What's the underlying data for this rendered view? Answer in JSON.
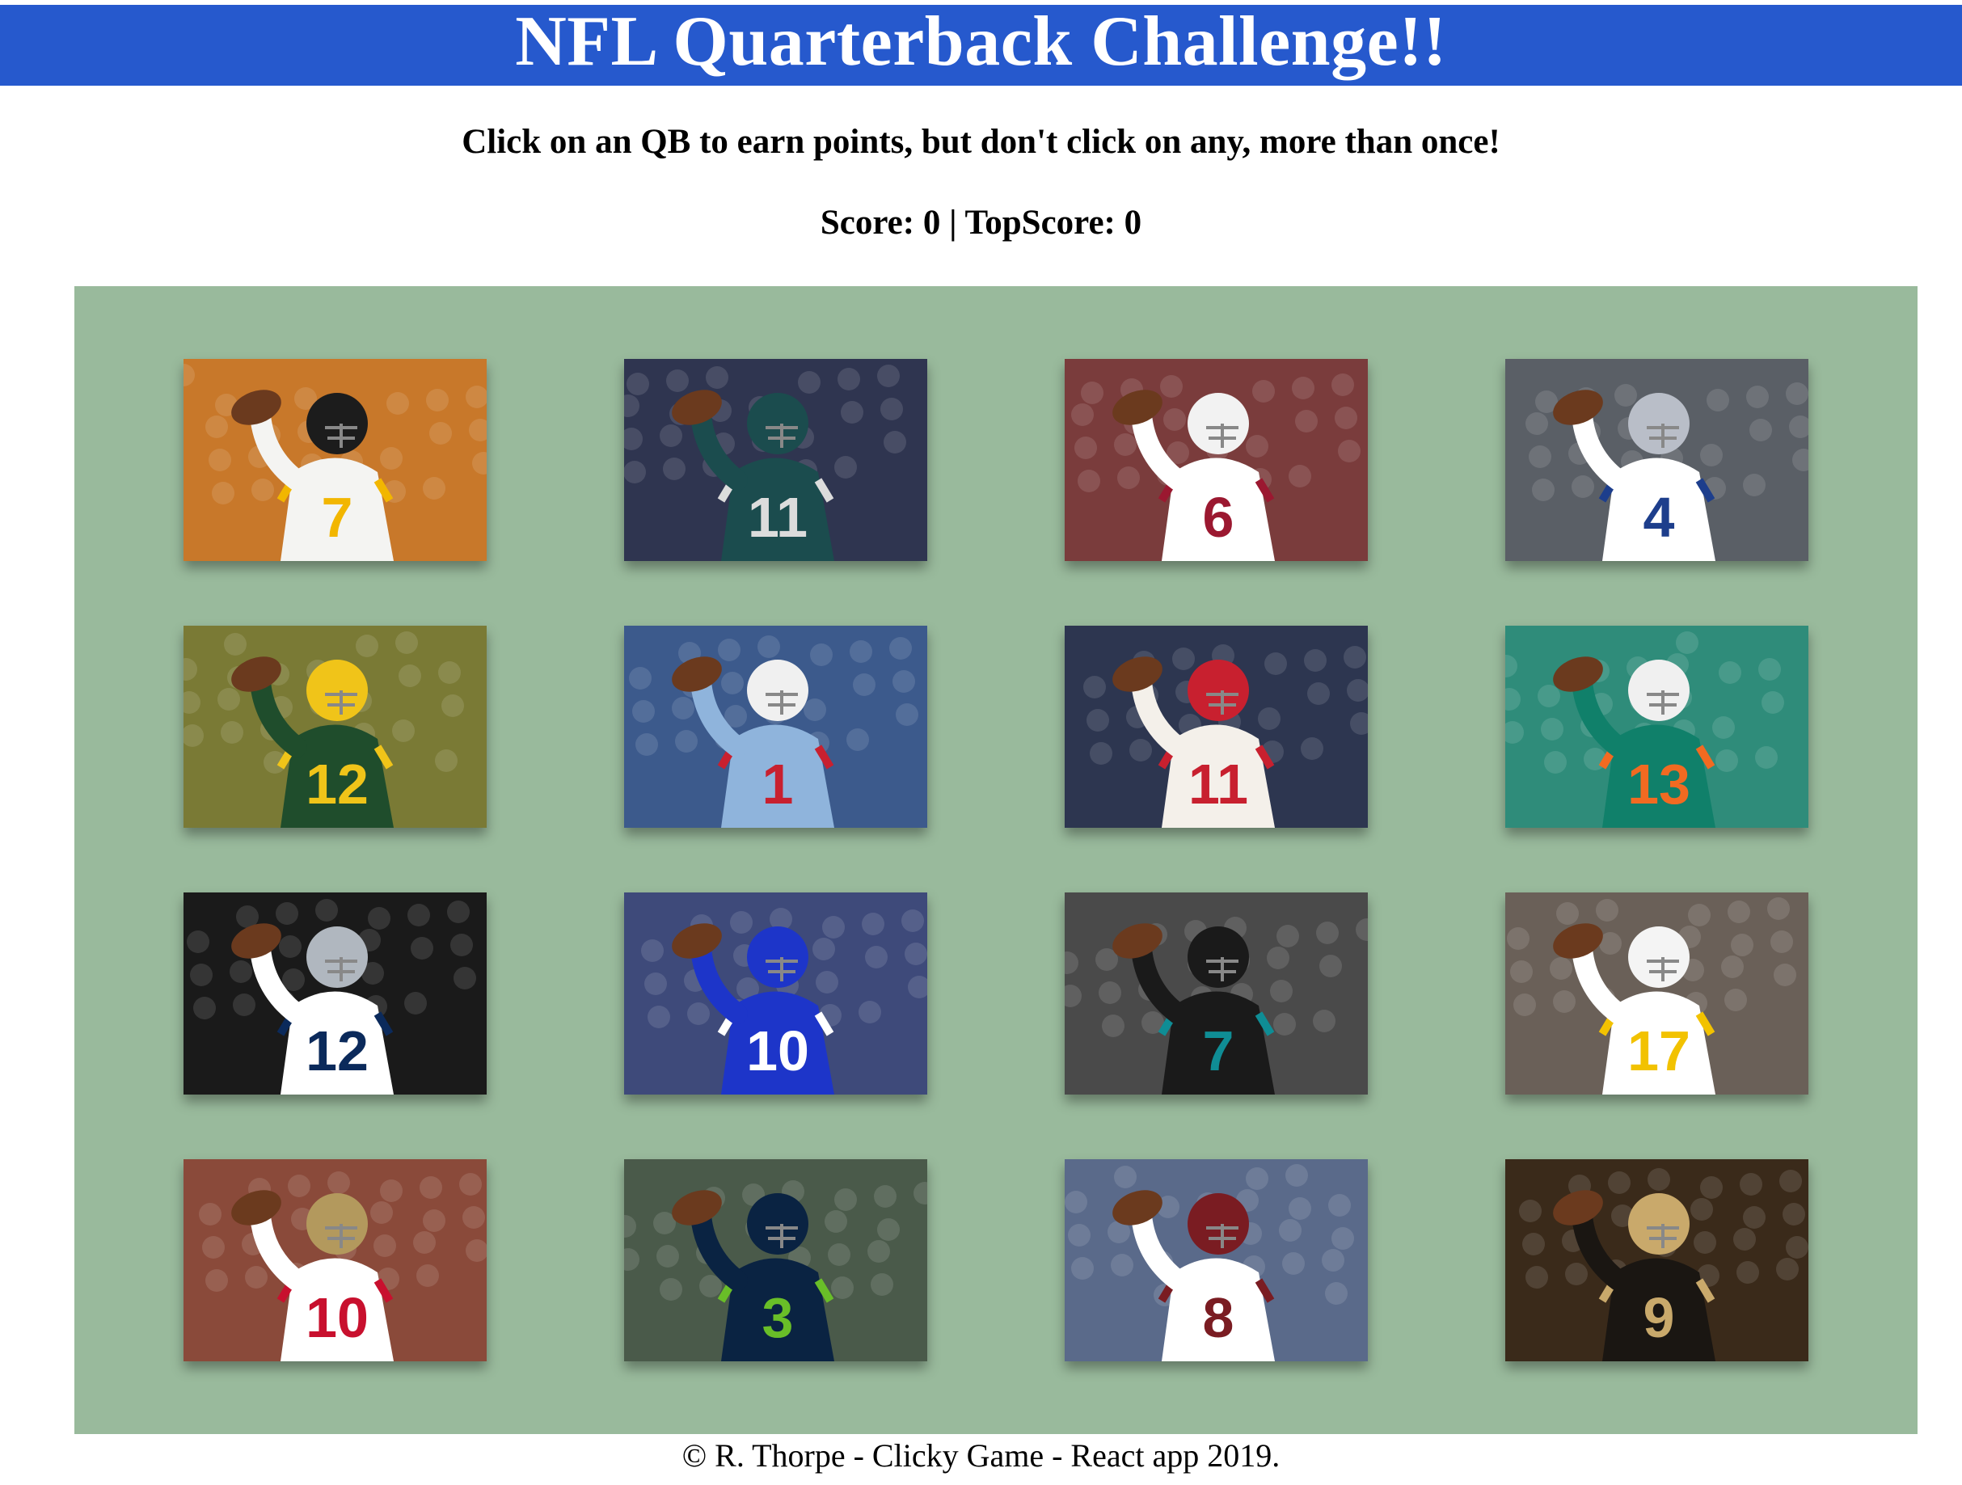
{
  "header": {
    "title": "NFL Quarterback Challenge!!"
  },
  "instructions": "Click on an QB to earn points, but don't click on any, more than once!",
  "score": {
    "text": "Score: 0 | TopScore: 0",
    "score": 0,
    "top_score": 0
  },
  "colors": {
    "header_bg": "#2659cd",
    "board_bg": "#99ba9c"
  },
  "cards": [
    {
      "jersey": "7",
      "primary": "#f4f4f2",
      "trim": "#f2b600",
      "helmet": "#1c1c1c",
      "crowd": "#c8782a"
    },
    {
      "jersey": "11",
      "primary": "#1b4c4e",
      "trim": "#dcdcdc",
      "helmet": "#1b4c4e",
      "crowd": "#2f3550"
    },
    {
      "jersey": "6",
      "primary": "#ffffff",
      "trim": "#9b1830",
      "helmet": "#f2f2f2",
      "crowd": "#7a3c3c"
    },
    {
      "jersey": "4",
      "primary": "#ffffff",
      "trim": "#1d3e8c",
      "helmet": "#b9bec8",
      "crowd": "#5a5f66"
    },
    {
      "jersey": "12",
      "primary": "#1f4d2c",
      "trim": "#f0c419",
      "helmet": "#f0c419",
      "crowd": "#7a7a35"
    },
    {
      "jersey": "1",
      "primary": "#8fb4dc",
      "trim": "#c8202f",
      "helmet": "#f0f0f0",
      "crowd": "#3c5a8c"
    },
    {
      "jersey": "11",
      "primary": "#f4f0ea",
      "trim": "#c8202f",
      "helmet": "#c8202f",
      "crowd": "#2d3650"
    },
    {
      "jersey": "13",
      "primary": "#10806a",
      "trim": "#f26a21",
      "helmet": "#f0f0f0",
      "crowd": "#2f8c7a"
    },
    {
      "jersey": "12",
      "primary": "#ffffff",
      "trim": "#0b2a5b",
      "helmet": "#b0b7bf",
      "crowd": "#1a1a1a"
    },
    {
      "jersey": "10",
      "primary": "#1d35c9",
      "trim": "#ffffff",
      "helmet": "#1d35c9",
      "crowd": "#3e4a7a"
    },
    {
      "jersey": "7",
      "primary": "#1a1a1a",
      "trim": "#0f8d95",
      "helmet": "#1a1a1a",
      "crowd": "#4a4a4a"
    },
    {
      "jersey": "17",
      "primary": "#ffffff",
      "trim": "#f2c200",
      "helmet": "#f4f4f4",
      "crowd": "#6a6058"
    },
    {
      "jersey": "10",
      "primary": "#ffffff",
      "trim": "#c8102e",
      "helmet": "#b3995d",
      "crowd": "#8a4a3a"
    },
    {
      "jersey": "3",
      "primary": "#0a2342",
      "trim": "#69be28",
      "helmet": "#0a2342",
      "crowd": "#4a5a4a"
    },
    {
      "jersey": "8",
      "primary": "#ffffff",
      "trim": "#7a1c22",
      "helmet": "#7a1c22",
      "crowd": "#5a6a8a"
    },
    {
      "jersey": "9",
      "primary": "#1a1612",
      "trim": "#c9a96b",
      "helmet": "#c9a96b",
      "crowd": "#3a2a1a"
    }
  ],
  "footer": "© R. Thorpe - Clicky Game - React app 2019."
}
